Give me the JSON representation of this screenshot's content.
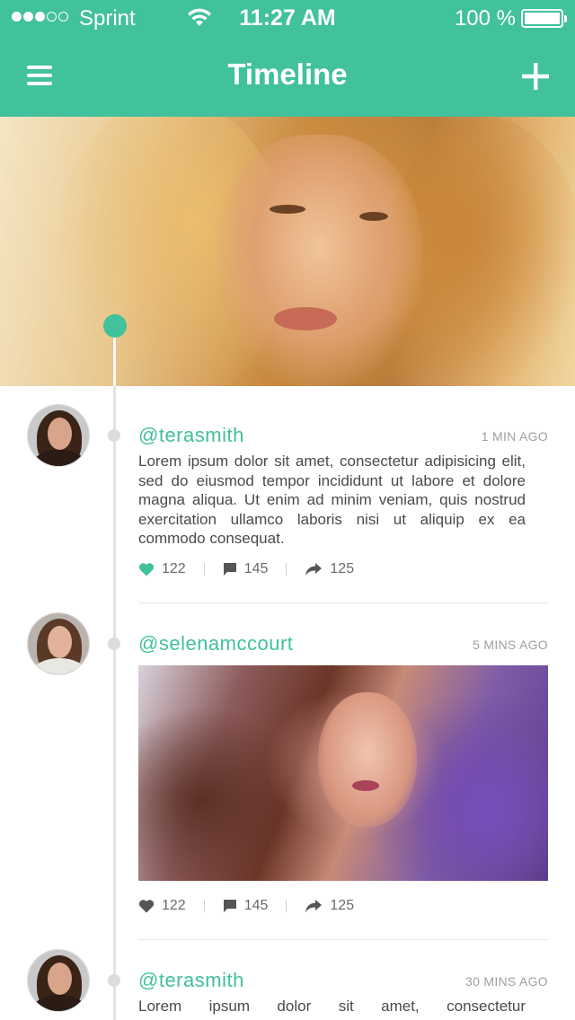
{
  "status_bar": {
    "carrier": "Sprint",
    "time": "11:27 AM",
    "battery_percent": "100 %",
    "signal_bars_filled": 3,
    "signal_bars_total": 5
  },
  "nav": {
    "title": "Timeline",
    "left_icon": "menu-icon",
    "right_icon": "plus-icon"
  },
  "colors": {
    "accent": "#41c19c",
    "text": "#4a4a4a",
    "muted": "#a0a0a0"
  },
  "posts": [
    {
      "username": "@terasmith",
      "time_ago": "1 MIN AGO",
      "text": "Lorem ipsum dolor sit amet, consectetur adipisicing elit, sed do eiusmod tempor incididunt ut labore et dolore magna aliqua. Ut enim ad minim veniam, quis nostrud exercitation ullamco laboris nisi ut aliquip ex ea commodo consequat.",
      "likes": "122",
      "comments": "145",
      "shares": "125",
      "liked": true
    },
    {
      "username": "@selenamccourt",
      "time_ago": "5 MINS AGO",
      "has_image": true,
      "likes": "122",
      "comments": "145",
      "shares": "125",
      "liked": false
    },
    {
      "username": "@terasmith",
      "time_ago": "30 MINS AGO",
      "text": "Lorem ipsum dolor sit amet, consectetur"
    }
  ]
}
